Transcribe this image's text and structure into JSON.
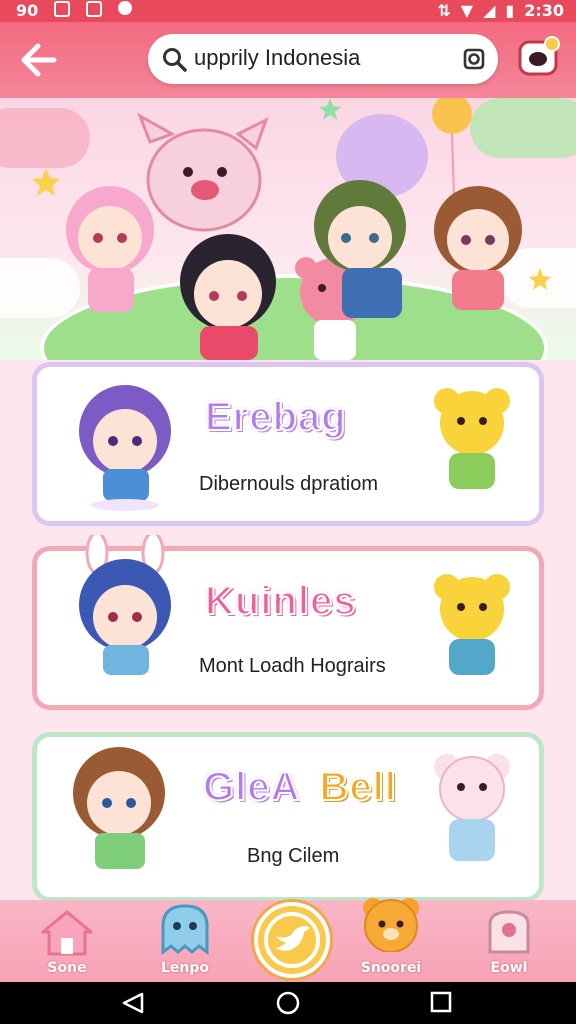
{
  "status_bar": {
    "left_text": "90",
    "time": "2:30"
  },
  "search": {
    "query": "upprily Indonesia"
  },
  "cards": [
    {
      "title": "Erebag",
      "subtitle": "Dibernouls dpratiom",
      "title_color": "#b57be6"
    },
    {
      "title": "Kuinles",
      "subtitle": "Mont Loadh Hograirs",
      "title_color": "#f05e9b"
    },
    {
      "title_left": "GleA",
      "title_right": "Bell",
      "subtitle": "Bng Cilem",
      "title_color": "#b57be6",
      "title_right_color": "#f5a623"
    }
  ],
  "bottom_nav": [
    {
      "label": "Sone",
      "icon": "home-icon"
    },
    {
      "label": "Lenpo",
      "icon": "ghost-icon"
    },
    {
      "label": "",
      "icon": "bird-icon"
    },
    {
      "label": "Snoorei",
      "icon": "bear-icon"
    },
    {
      "label": "Eowl",
      "icon": "profile-icon"
    }
  ],
  "colors": {
    "accent": "#e94a5b",
    "pink": "#f7a3b7",
    "purple": "#b57be6"
  }
}
